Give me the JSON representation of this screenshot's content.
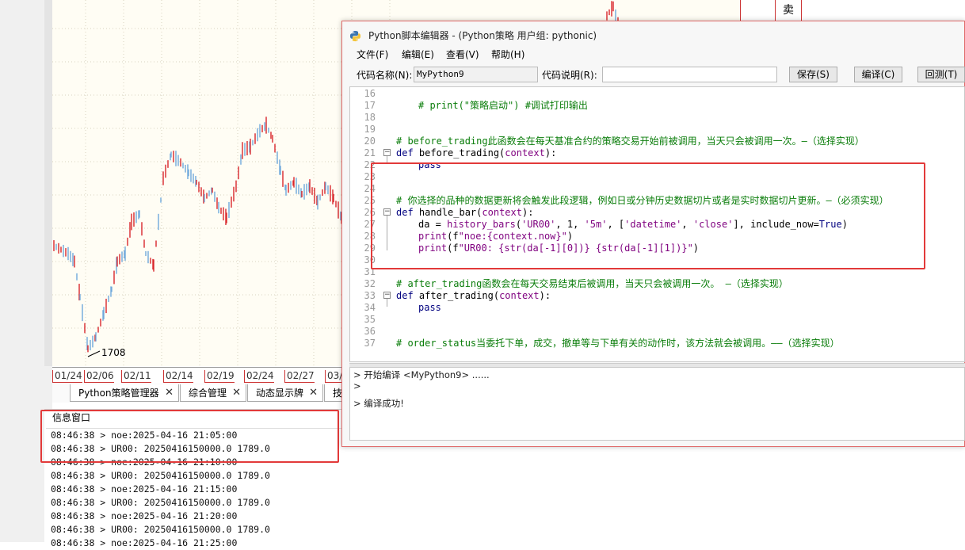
{
  "chart": {
    "low_label": "1708",
    "sell_label": "卖",
    "dates": [
      "01/24",
      "02/06",
      "02/11",
      "02/14",
      "02/19",
      "02/24",
      "02/27",
      "03/"
    ]
  },
  "bottom_tabs": [
    {
      "label": "Python策略管理器"
    },
    {
      "label": "综合管理"
    },
    {
      "label": "动态显示牌"
    },
    {
      "label": "技"
    }
  ],
  "info_window": {
    "title": "信息窗口",
    "lines": [
      "08:46:38 > noe:2025-04-16 21:05:00",
      "08:46:38 > UR00: 20250416150000.0 1789.0",
      "08:46:38 > noe:2025-04-16 21:10:00",
      "08:46:38 > UR00: 20250416150000.0 1789.0",
      "08:46:38 > noe:2025-04-16 21:15:00",
      "08:46:38 > UR00: 20250416150000.0 1789.0",
      "08:46:38 > noe:2025-04-16 21:20:00",
      "08:46:38 > UR00: 20250416150000.0 1789.0",
      "08:46:38 > noe:2025-04-16 21:25:00"
    ]
  },
  "editor": {
    "title": "Python脚本编辑器 - (Python策略 用户组: pythonic)",
    "menu": [
      "文件(F)",
      "编辑(E)",
      "查看(V)",
      "帮助(H)"
    ],
    "code_name_label": "代码名称(N):",
    "code_name_value": "MyPython9",
    "code_desc_label": "代码说明(R):",
    "code_desc_value": "",
    "buttons": {
      "save": "保存(S)",
      "compile": "编译(C)",
      "backtest": "回测(T)"
    },
    "line_numbers": [
      "16",
      "17",
      "18",
      "19",
      "20",
      "21",
      "22",
      "23",
      "24",
      "25",
      "26",
      "27",
      "28",
      "29",
      "30",
      "31",
      "32",
      "33",
      "34",
      "35",
      "36",
      "37"
    ],
    "code": {
      "l17": "# print(\"策略启动\") #调试打印输出",
      "l20": "# before_trading此函数会在每天基准合约的策略交易开始前被调用，当天只会被调用一次。—（选择实现）",
      "l21a": "def ",
      "l21b": "before_trading(",
      "l21c": "context",
      "l21d": "):",
      "l22": "pass",
      "l25": "# 你选择的品种的数据更新将会触发此段逻辑，例如日或分钟历史数据切片或者是实时数据切片更新。—（必须实现）",
      "l26a": "def ",
      "l26b": "handle_bar(",
      "l26c": "context",
      "l26d": "):",
      "l27a": "da = ",
      "l27b": "history_bars",
      "l27c": "(",
      "l27d": "'UR00'",
      "l27e": ", 1, ",
      "l27f": "'5m'",
      "l27g": ", [",
      "l27h": "'datetime'",
      "l27i": ", ",
      "l27j": "'close'",
      "l27k": "], include_now=",
      "l27l": "True",
      "l27m": ")",
      "l28a": "print",
      "l28b": "(f",
      "l28c": "\"noe:{context.now}\"",
      "l28d": ")",
      "l29a": "print",
      "l29b": "(f",
      "l29c": "\"UR00: {str(da[-1][0])} {str(da[-1][1])}\"",
      "l29d": ")",
      "l32": "# after_trading函数会在每天交易结束后被调用，当天只会被调用一次。 —（选择实现）",
      "l33a": "def ",
      "l33b": "after_trading(",
      "l33c": "context",
      "l33d": "):",
      "l34": "pass",
      "l37": "# order_status当委托下单，成交，撤单等与下单有关的动作时，该方法就会被调用。——（选择实现）"
    },
    "output": [
      "> 开始编译 <MyPython9> ......",
      "> ",
      "> 编译成功!"
    ]
  },
  "colors": {
    "up": "#d9262b",
    "down": "#6fa8dc",
    "highlight": "#e23a3a",
    "chart_bg": "#fffdf4"
  }
}
